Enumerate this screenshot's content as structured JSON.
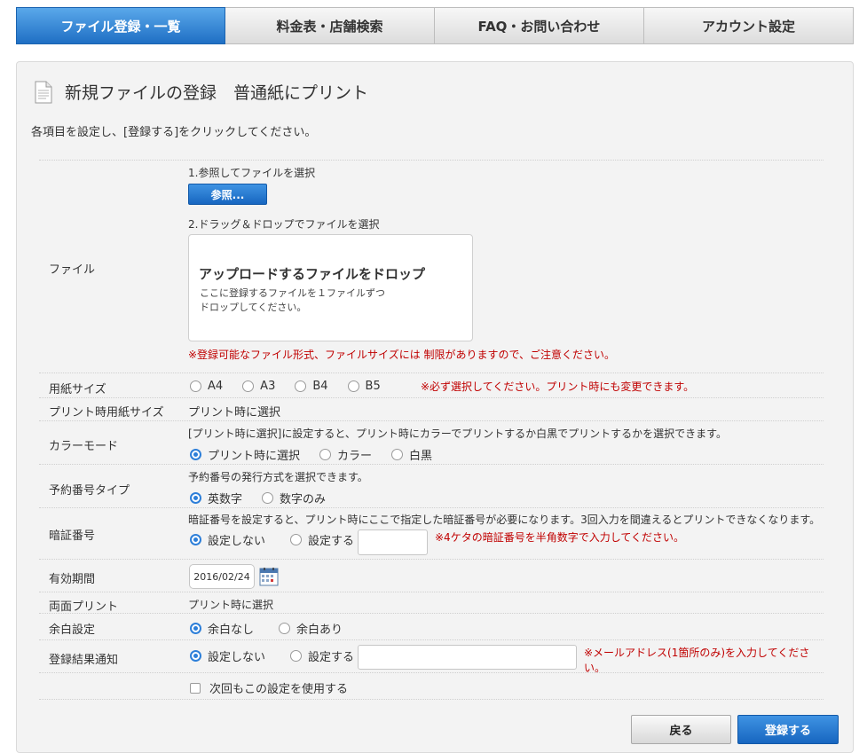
{
  "tabs": [
    {
      "label": "ファイル登録・一覧",
      "active": true
    },
    {
      "label": "料金表・店舗検索",
      "active": false
    },
    {
      "label": "FAQ・お問い合わせ",
      "active": false
    },
    {
      "label": "アカウント設定",
      "active": false
    }
  ],
  "page": {
    "title": "新規ファイルの登録　普通紙にプリント",
    "intro": "各項目を設定し、[登録する]をクリックしてください。"
  },
  "file": {
    "label": "ファイル",
    "step1": "1.参照してファイルを選択",
    "browse_button": "参照...",
    "step2": "2.ドラッグ＆ドロップでファイルを選択",
    "drop_title": "アップロードするファイルをドロップ",
    "drop_desc_line1": "ここに登録するファイルを１ファイルずつ",
    "drop_desc_line2": "ドロップしてください。",
    "notice": "※登録可能なファイル形式、ファイルサイズには 制限がありますので、ご注意ください。"
  },
  "paper_size": {
    "label": "用紙サイズ",
    "options": [
      "A4",
      "A3",
      "B4",
      "B5"
    ],
    "note": "※必ず選択してください。プリント時にも変更できます。"
  },
  "print_paper_size": {
    "label": "プリント時用紙サイズ",
    "value": "プリント時に選択"
  },
  "color_mode": {
    "label": "カラーモード",
    "desc": "[プリント時に選択]に設定すると、プリント時にカラーでプリントするか白黒でプリントするかを選択できます。",
    "options": [
      "プリント時に選択",
      "カラー",
      "白黒"
    ],
    "selected": 0
  },
  "reservation_type": {
    "label": "予約番号タイプ",
    "desc": "予約番号の発行方式を選択できます。",
    "options": [
      "英数字",
      "数字のみ"
    ],
    "selected": 0
  },
  "pin": {
    "label": "暗証番号",
    "desc": "暗証番号を設定すると、プリント時にここで指定した暗証番号が必要になります。3回入力を間違えるとプリントできなくなります。",
    "options": [
      "設定しない",
      "設定する"
    ],
    "selected": 0,
    "input_value": "",
    "note": "※4ケタの暗証番号を半角数字で入力してください。"
  },
  "expiry": {
    "label": "有効期間",
    "date": "2016/02/24",
    "icon": "calendar-icon"
  },
  "duplex": {
    "label": "両面プリント",
    "value": "プリント時に選択"
  },
  "margin": {
    "label": "余白設定",
    "options": [
      "余白なし",
      "余白あり"
    ],
    "selected": 0
  },
  "notify": {
    "label": "登録結果通知",
    "options": [
      "設定しない",
      "設定する"
    ],
    "selected": 0,
    "input_value": "",
    "note": "※メールアドレス(1箇所のみ)を入力してください。"
  },
  "remember": {
    "label": "次回もこの設定を使用する",
    "checked": false
  },
  "actions": {
    "back": "戻る",
    "submit": "登録する"
  },
  "colors": {
    "accent": "#1f6fc4",
    "warning": "#c00000",
    "panel": "#f3f3f3"
  }
}
